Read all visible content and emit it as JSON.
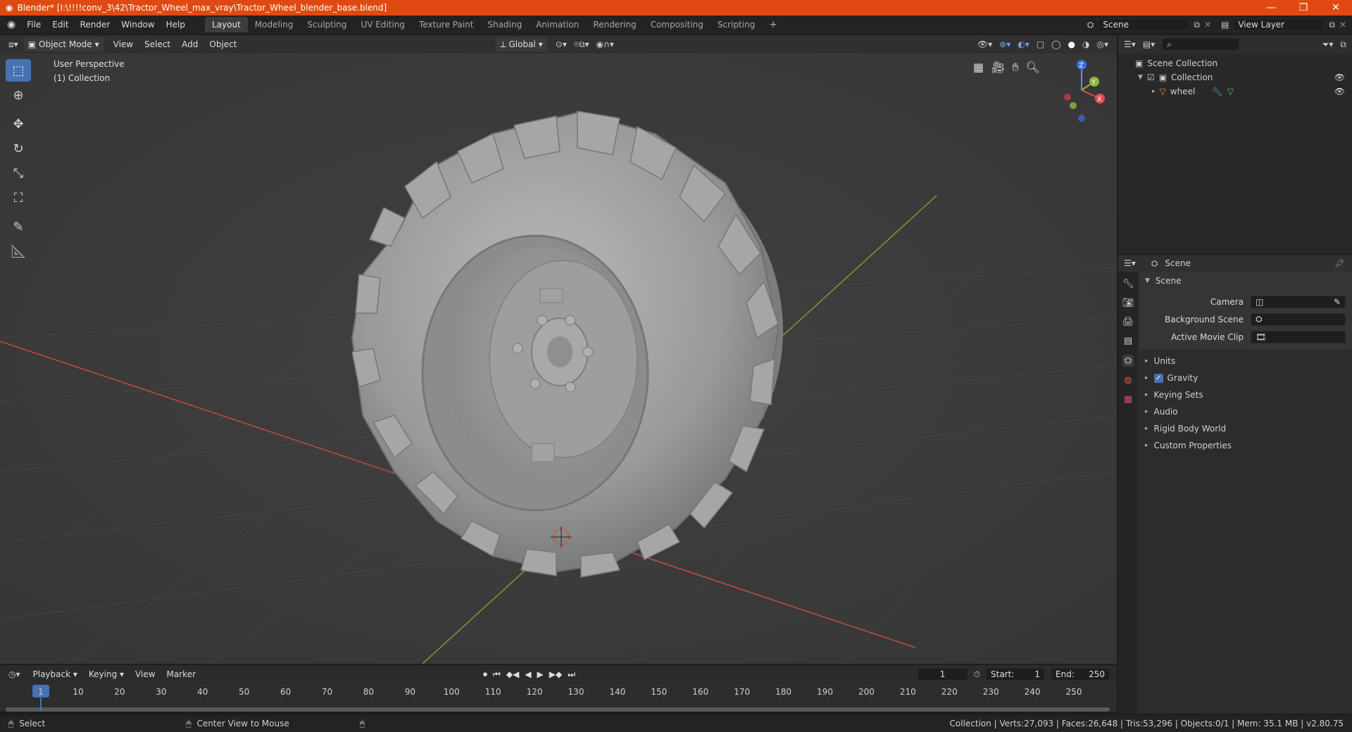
{
  "window": {
    "title": "Blender* [I:\\!!!!conv_3\\42\\Tractor_Wheel_max_vray\\Tractor_Wheel_blender_base.blend]",
    "minimize": "—",
    "maximize": "❐",
    "close": "✕"
  },
  "menu": [
    "File",
    "Edit",
    "Render",
    "Window",
    "Help"
  ],
  "workspaces": [
    "Layout",
    "Modeling",
    "Sculpting",
    "UV Editing",
    "Texture Paint",
    "Shading",
    "Animation",
    "Rendering",
    "Compositing",
    "Scripting"
  ],
  "active_workspace": "Layout",
  "add_workspace": "+",
  "scene_field": "Scene",
  "view_layer_field": "View Layer",
  "viewport_header": {
    "mode": "Object Mode",
    "menus": [
      "View",
      "Select",
      "Add",
      "Object"
    ],
    "transform_orientation": "Global"
  },
  "viewport_overlay": {
    "perspective": "User Perspective",
    "collection": "(1) Collection"
  },
  "gizmo": {
    "z": "Z",
    "y": "Y",
    "x": "X"
  },
  "outliner": {
    "root": "Scene Collection",
    "collection": "Collection",
    "object": "wheel"
  },
  "properties": {
    "context": "Scene",
    "panel_title": "Scene",
    "fields": [
      {
        "label": "Camera",
        "value": ""
      },
      {
        "label": "Background Scene",
        "value": ""
      },
      {
        "label": "Active Movie Clip",
        "value": ""
      }
    ],
    "subpanels": [
      "Units",
      "Gravity",
      "Keying Sets",
      "Audio",
      "Rigid Body World",
      "Custom Properties"
    ],
    "gravity_checked": true
  },
  "timeline": {
    "menus": [
      "Playback",
      "Keying",
      "View",
      "Marker"
    ],
    "current_frame": "1",
    "start_label": "Start:",
    "start": "1",
    "end_label": "End:",
    "end": "250",
    "ticks": [
      1,
      10,
      20,
      30,
      40,
      50,
      60,
      70,
      80,
      90,
      100,
      110,
      120,
      130,
      140,
      150,
      160,
      170,
      180,
      190,
      200,
      210,
      220,
      230,
      240,
      250
    ]
  },
  "statusbar": {
    "left": "Select",
    "middle": "Center View to Mouse",
    "stats": "Collection | Verts:27,093 | Faces:26,648 | Tris:53,296 | Objects:0/1 | Mem: 35.1 MB | v2.80.75"
  },
  "colors": {
    "titlebar": "#e04a12",
    "accent": "#4772b3",
    "viewport_bg": "#3b3b3b",
    "x_axis": "#c44a4a",
    "y_axis": "#7d9a3a"
  }
}
